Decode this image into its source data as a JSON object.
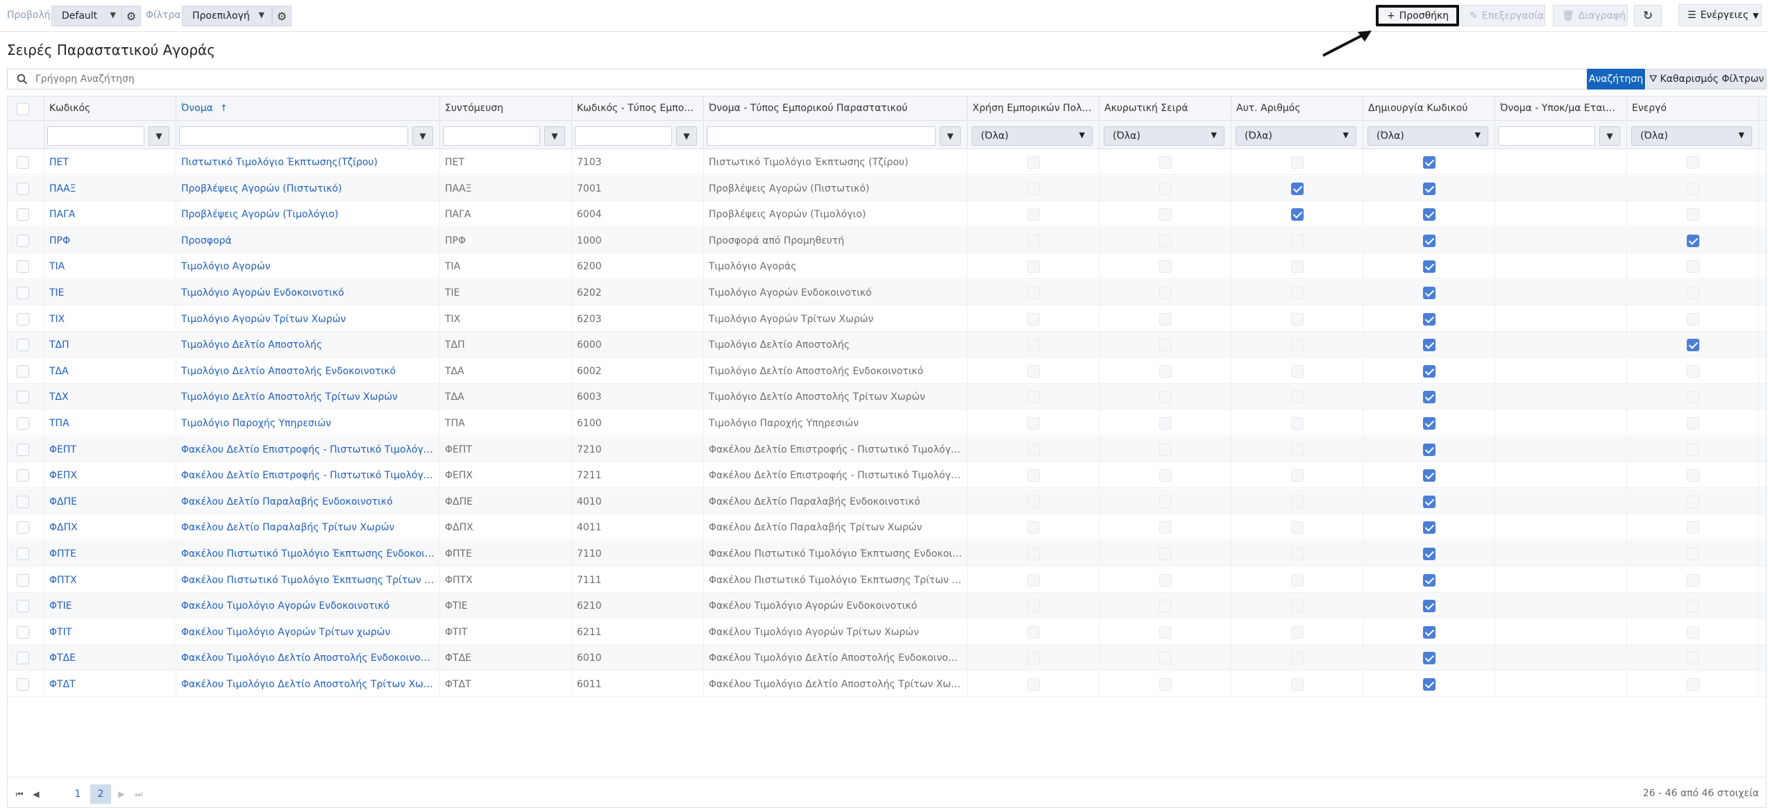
{
  "toolbar": {
    "view_label": "Προβολή",
    "view_value": "Default",
    "filter_label": "Φίλτρα",
    "filter_value": "Προεπιλογή",
    "add_label": "Προσθήκη",
    "edit_label": "Επεξεργασία",
    "delete_label": "Διαγραφή",
    "actions_label": "Ενέργειες"
  },
  "page_title": "Σειρές Παραστατικού Αγοράς",
  "search": {
    "placeholder": "Γρήγορη Αναζήτηση",
    "search_button": "Αναζήτηση",
    "clear_button": "Καθαρισμός Φίλτρων"
  },
  "columns": {
    "code": "Κωδικός",
    "name": "Όνομα",
    "abbr": "Συντόμευση",
    "type_code": "Κωδικός - Τύπος Εμπορικού Παραστατικού",
    "type_name": "Όνομα - Τύπος Εμπορικού Παραστατικού",
    "use_policies": "Χρήση Εμπορικών Πολιτικών",
    "cancel_series": "Ακυρωτική Σειρά",
    "auto_number": "Αυτ. Αριθμός",
    "create_code": "Δημιουργία Κωδικού",
    "branch_name": "Όνομα - Υποκ/μα Εταιρίας",
    "active": "Ενεργό"
  },
  "filter_all": "(Όλα)",
  "rows": [
    {
      "code": "ΠΕΤ",
      "name": "Πιστωτικό Τιμολόγιο Έκπτωσης(Τζίρου)",
      "abbr": "ΠΕΤ",
      "type_code": "7103",
      "type_name": "Πιστωτικό Τιμολόγιο Έκπτωσης (Τζίρου)",
      "auto": false,
      "create": true,
      "active": false
    },
    {
      "code": "ΠΑΑΞ",
      "name": "Προβλέψεις Αγορών (Πιστωτικό)",
      "abbr": "ΠΑΑΞ",
      "type_code": "7001",
      "type_name": "Προβλέψεις Αγορών (Πιστωτικό)",
      "auto": true,
      "create": true,
      "active": false
    },
    {
      "code": "ΠΑΓΑ",
      "name": "Προβλέψεις Αγορών (Τιμολόγιο)",
      "abbr": "ΠΑΓΑ",
      "type_code": "6004",
      "type_name": "Προβλέψεις Αγορών (Τιμολόγιο)",
      "auto": true,
      "create": true,
      "active": false
    },
    {
      "code": "ΠΡΦ",
      "name": "Προσφορά",
      "abbr": "ΠΡΦ",
      "type_code": "1000",
      "type_name": "Προσφορά από Προμηθευτή",
      "auto": false,
      "create": true,
      "active": true
    },
    {
      "code": "ΤΙΑ",
      "name": "Τιμολόγιο Αγορών",
      "abbr": "ΤΙΑ",
      "type_code": "6200",
      "type_name": "Τιμολόγιο Αγοράς",
      "auto": false,
      "create": true,
      "active": false
    },
    {
      "code": "ΤΙΕ",
      "name": "Τιμολόγιο Αγορών Ενδοκοινοτικό",
      "abbr": "ΤΙΕ",
      "type_code": "6202",
      "type_name": "Τιμολόγιο Αγορών Ενδοκοινοτικό",
      "auto": false,
      "create": true,
      "active": false
    },
    {
      "code": "ΤΙΧ",
      "name": "Τιμολόγιο Αγορών Τρίτων Χωρών",
      "abbr": "ΤΙΧ",
      "type_code": "6203",
      "type_name": "Τιμολόγιο Αγορών Τρίτων Χωρών",
      "auto": false,
      "create": true,
      "active": false
    },
    {
      "code": "ΤΔΠ",
      "name": "Τιμολόγιο Δελτίο Αποστολής",
      "abbr": "ΤΔΠ",
      "type_code": "6000",
      "type_name": "Τιμολόγιο Δελτίο Αποστολής",
      "auto": false,
      "create": true,
      "active": true
    },
    {
      "code": "ΤΔΑ",
      "name": "Τιμολόγιο Δελτίο Αποστολής Ενδοκοινοτικό",
      "abbr": "ΤΔΑ",
      "type_code": "6002",
      "type_name": "Τιμολόγιο Δελτίο Αποστολής Ενδοκοινοτικό",
      "auto": false,
      "create": true,
      "active": false
    },
    {
      "code": "ΤΔΧ",
      "name": "Τιμολόγιο Δελτίο Αποστολής Τρίτων Χωρών",
      "abbr": "ΤΔΑ",
      "type_code": "6003",
      "type_name": "Τιμολόγιο Δελτίο Αποστολής Τρίτων Χωρών",
      "auto": false,
      "create": true,
      "active": false
    },
    {
      "code": "ΤΠΑ",
      "name": "Τιμολόγιο Παροχής Υπηρεσιών",
      "abbr": "ΤΠΑ",
      "type_code": "6100",
      "type_name": "Τιμολόγιο Παροχής Υπηρεσιών",
      "auto": false,
      "create": true,
      "active": false
    },
    {
      "code": "ΦΕΠΤ",
      "name": "Φακέλου Δελτίο Επιστροφής - Πιστωτικό Τιμολόγιο Ενδοκοινοτικό",
      "abbr": "ΦΕΠΤ",
      "type_code": "7210",
      "type_name": "Φακέλου Δελτίο Επιστροφής - Πιστωτικό Τιμολόγιο Ενδοκοινοτικό",
      "auto": false,
      "create": true,
      "active": false
    },
    {
      "code": "ΦΕΠΧ",
      "name": "Φακέλου Δελτίο Επιστροφής - Πιστωτικό Τιμολόγιο Τρίτων Χωρών",
      "abbr": "ΦΕΠΧ",
      "type_code": "7211",
      "type_name": "Φακέλου Δελτίο Επιστροφής - Πιστωτικό Τιμολόγιο Τρίτων Χωρών",
      "auto": false,
      "create": true,
      "active": false
    },
    {
      "code": "ΦΔΠΕ",
      "name": "Φακέλου Δελτίο Παραλαβής Ενδοκοινοτικό",
      "abbr": "ΦΔΠΕ",
      "type_code": "4010",
      "type_name": "Φακέλου Δελτίο Παραλαβής Ενδοκοινοτικό",
      "auto": false,
      "create": true,
      "active": false
    },
    {
      "code": "ΦΔΠΧ",
      "name": "Φακέλου Δελτίο Παραλαβής Τρίτων Χωρών",
      "abbr": "ΦΔΠΧ",
      "type_code": "4011",
      "type_name": "Φακέλου Δελτίο Παραλαβής Τρίτων Χωρών",
      "auto": false,
      "create": true,
      "active": false
    },
    {
      "code": "ΦΠΤΕ",
      "name": "Φακέλου Πιστωτικό Τιμολόγιο Έκπτωσης Ενδοκοινοτικό",
      "abbr": "ΦΠΤΕ",
      "type_code": "7110",
      "type_name": "Φακέλου Πιστωτικό Τιμολόγιο Έκπτωσης Ενδοκοινοτικό",
      "auto": false,
      "create": true,
      "active": false
    },
    {
      "code": "ΦΠΤΧ",
      "name": "Φακέλου Πιστωτικό Τιμολόγιο Έκπτωσης Τρίτων Χωρών",
      "abbr": "ΦΠΤΧ",
      "type_code": "7111",
      "type_name": "Φακέλου Πιστωτικό Τιμολόγιο Έκπτωσης Τρίτων Χωρών",
      "auto": false,
      "create": true,
      "active": false
    },
    {
      "code": "ΦΤΙΕ",
      "name": "Φακέλου Τιμολόγιο Αγορών Ενδοκοινοτικό",
      "abbr": "ΦΤΙΕ",
      "type_code": "6210",
      "type_name": "Φακέλου Τιμολόγιο Αγορών Ενδοκοινοτικό",
      "auto": false,
      "create": true,
      "active": false
    },
    {
      "code": "ΦΤΙΤ",
      "name": "Φακέλου Τιμολόγιο Αγορών Τρίτων χωρών",
      "abbr": "ΦΤΙΤ",
      "type_code": "6211",
      "type_name": "Φακέλου Τιμολόγιο Αγορών Τρίτων Χωρών",
      "auto": false,
      "create": true,
      "active": false
    },
    {
      "code": "ΦΤΔΕ",
      "name": "Φακέλου Τιμολόγιο Δελτίο Αποστολής Ενδοκοινοτικό",
      "abbr": "ΦΤΔΕ",
      "type_code": "6010",
      "type_name": "Φακέλου Τιμολόγιο Δελτίο Αποστολής Ενδοκοινοτικό",
      "auto": false,
      "create": true,
      "active": false
    },
    {
      "code": "ΦΤΔΤ",
      "name": "Φακέλου Τιμολόγιο Δελτίο Αποστολής Τρίτων Χωρών",
      "abbr": "ΦΤΔΤ",
      "type_code": "6011",
      "type_name": "Φακέλου Τιμολόγιο Δελτίο Αποστολής Τρίτων Χωρών",
      "auto": false,
      "create": true,
      "active": false
    }
  ],
  "pager": {
    "page1": "1",
    "page2": "2",
    "info": "26 - 46 από 46 στοιχεία"
  },
  "colors": {
    "accent": "#1565c0",
    "link": "#1f5fbf",
    "checkbox_on": "#4a7fd6"
  }
}
